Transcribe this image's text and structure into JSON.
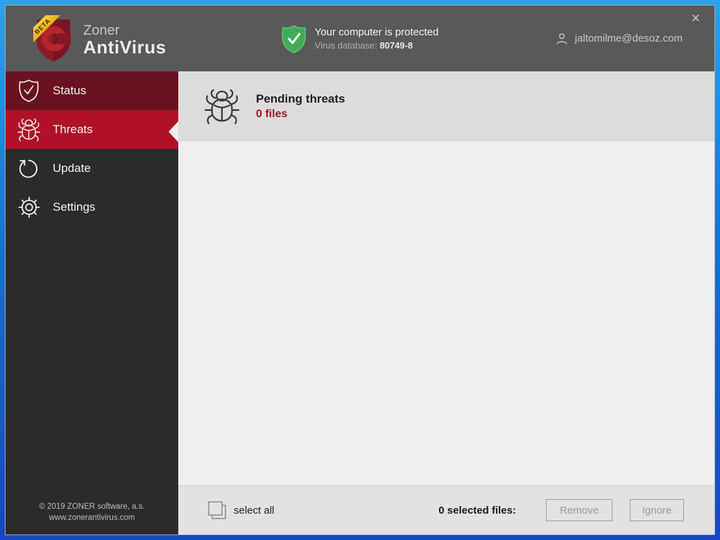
{
  "window": {
    "close_glyph": "✕"
  },
  "header": {
    "brand": {
      "line1": "Zoner",
      "line2": "AntiVirus",
      "beta": "BETA"
    },
    "protection": {
      "title": "Your computer is protected",
      "db_label": "Virus database: ",
      "db_value": "80749-8"
    },
    "account": {
      "email": "jaltomilme@desoz.com"
    }
  },
  "sidebar": {
    "items": [
      {
        "label": "Status"
      },
      {
        "label": "Threats"
      },
      {
        "label": "Update"
      },
      {
        "label": "Settings"
      }
    ],
    "footer": {
      "line1": "© 2019  ZONER software, a.s.",
      "line2": "www.zonerantivirus.com"
    }
  },
  "main": {
    "header": {
      "title": "Pending threats",
      "count": "0 files"
    }
  },
  "bottombar": {
    "select_all_label": "select all",
    "selected_label": "0 selected files:",
    "remove_label": "Remove",
    "ignore_label": "Ignore"
  },
  "colors": {
    "accent_red": "#b01128",
    "dark_red": "#6b1220",
    "status_green": "#3fad57",
    "titlebar_gray": "#58595b",
    "sidebar_dark": "#2b2b2c",
    "count_red": "#a5112c"
  }
}
